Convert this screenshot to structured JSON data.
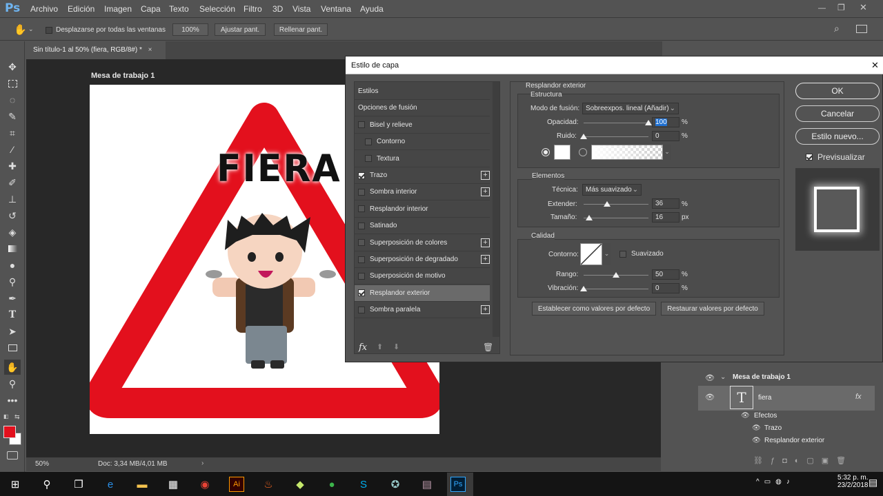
{
  "app": {
    "logo": "Ps"
  },
  "menu": [
    "Archivo",
    "Edición",
    "Imagen",
    "Capa",
    "Texto",
    "Selección",
    "Filtro",
    "3D",
    "Vista",
    "Ventana",
    "Ayuda"
  ],
  "options": {
    "scroll_all": "Desplazarse por todas las ventanas",
    "zoom": "100%",
    "fit": "Ajustar pant.",
    "fill": "Rellenar pant."
  },
  "document": {
    "tab_title": "Sin título-1 al 50% (fiera, RGB/8#) *",
    "close": "×",
    "artboard_label": "Mesa de trabajo 1",
    "sign_text": "FIERA"
  },
  "status": {
    "zoom": "50%",
    "doc": "Doc: 3,34 MB/4,01 MB"
  },
  "dialog": {
    "title": "Estilo de capa",
    "close": "✕",
    "styles": [
      {
        "label": "Estilos",
        "check": false,
        "hascb": false,
        "plus": false,
        "indent": 0
      },
      {
        "label": "Opciones de fusión",
        "check": false,
        "hascb": false,
        "plus": false,
        "indent": 0
      },
      {
        "label": "Bisel y relieve",
        "check": false,
        "hascb": true,
        "plus": false,
        "indent": 0
      },
      {
        "label": "Contorno",
        "check": false,
        "hascb": true,
        "plus": false,
        "indent": 1
      },
      {
        "label": "Textura",
        "check": false,
        "hascb": true,
        "plus": false,
        "indent": 1
      },
      {
        "label": "Trazo",
        "check": true,
        "hascb": true,
        "plus": true,
        "indent": 0
      },
      {
        "label": "Sombra interior",
        "check": false,
        "hascb": true,
        "plus": true,
        "indent": 0
      },
      {
        "label": "Resplandor interior",
        "check": false,
        "hascb": true,
        "plus": false,
        "indent": 0
      },
      {
        "label": "Satinado",
        "check": false,
        "hascb": true,
        "plus": false,
        "indent": 0
      },
      {
        "label": "Superposición de colores",
        "check": false,
        "hascb": true,
        "plus": true,
        "indent": 0
      },
      {
        "label": "Superposición de degradado",
        "check": false,
        "hascb": true,
        "plus": true,
        "indent": 0
      },
      {
        "label": "Superposición de motivo",
        "check": false,
        "hascb": true,
        "plus": false,
        "indent": 0
      },
      {
        "label": "Resplandor exterior",
        "check": true,
        "hascb": true,
        "plus": false,
        "indent": 0,
        "selected": true
      },
      {
        "label": "Sombra paralela",
        "check": false,
        "hascb": true,
        "plus": true,
        "indent": 0
      }
    ],
    "fx_label": "fx",
    "section_title": "Resplandor exterior",
    "structure": {
      "title": "Estructura",
      "blend_mode_label": "Modo de fusión:",
      "blend_mode": "Sobreexpos. lineal (Añadir)",
      "opacity_label": "Opacidad:",
      "opacity": "100",
      "opacity_pct": 100,
      "noise_label": "Ruido:",
      "noise": "0",
      "noise_pct": 0,
      "glow_color": "#ffffff",
      "unit_pct": "%"
    },
    "elements": {
      "title": "Elementos",
      "technique_label": "Técnica:",
      "technique": "Más suavizado",
      "spread_label": "Extender:",
      "spread": "36",
      "spread_pct": 36,
      "size_label": "Tamaño:",
      "size": "16",
      "size_frac": 0.08,
      "unit_px": "px"
    },
    "quality": {
      "title": "Calidad",
      "contour_label": "Contorno:",
      "antialias_label": "Suavizado",
      "range_label": "Rango:",
      "range": "50",
      "range_pct": 50,
      "jitter_label": "Vibración:",
      "jitter": "0",
      "jitter_pct": 0
    },
    "buttons": {
      "defaults": "Establecer como valores por defecto",
      "reset": "Restaurar valores por defecto",
      "ok": "OK",
      "cancel": "Cancelar",
      "new_style": "Estilo nuevo...",
      "preview": "Previsualizar"
    }
  },
  "layers": {
    "artboard": "Mesa de trabajo 1",
    "layer_name": "fiera",
    "effects": "Efectos",
    "effect1": "Trazo",
    "effect2": "Resplandor exterior",
    "fx": "fx"
  },
  "taskbar": {
    "time": "5:32 p. m.",
    "date": "23/2/2018"
  },
  "colors": {
    "sign_red": "#e3101d",
    "foreground": "#e3101d",
    "background": "#ffffff",
    "accent": "#6fb4f0"
  }
}
